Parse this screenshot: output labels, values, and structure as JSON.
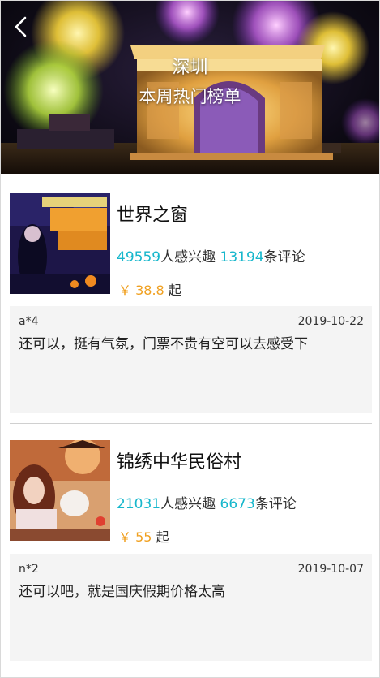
{
  "header": {
    "city": "深圳",
    "subtitle": "本周热门榜单",
    "back_icon": "chevron-left-icon"
  },
  "items": [
    {
      "name": "世界之窗",
      "interest_count": "49559",
      "interest_label": "人感兴趣",
      "comment_count": "13194",
      "comment_label": "条评论",
      "price_symbol": "￥",
      "price": "38.8",
      "price_suffix": "起",
      "review": {
        "user": "a*4",
        "date": "2019-10-22",
        "text": "还可以，挺有气氛，门票不贵有空可以去感受下"
      }
    },
    {
      "name": "锦绣中华民俗村",
      "interest_count": "21031",
      "interest_label": "人感兴趣",
      "comment_count": "6673",
      "comment_label": "条评论",
      "price_symbol": "￥",
      "price": "55",
      "price_suffix": "起",
      "review": {
        "user": "n*2",
        "date": "2019-10-07",
        "text": "还可以吧，就是国庆假期价格太高"
      }
    }
  ],
  "colors": {
    "count_accent": "#17b7cc",
    "price_accent": "#f0a020",
    "review_bg": "#f4f4f4"
  }
}
